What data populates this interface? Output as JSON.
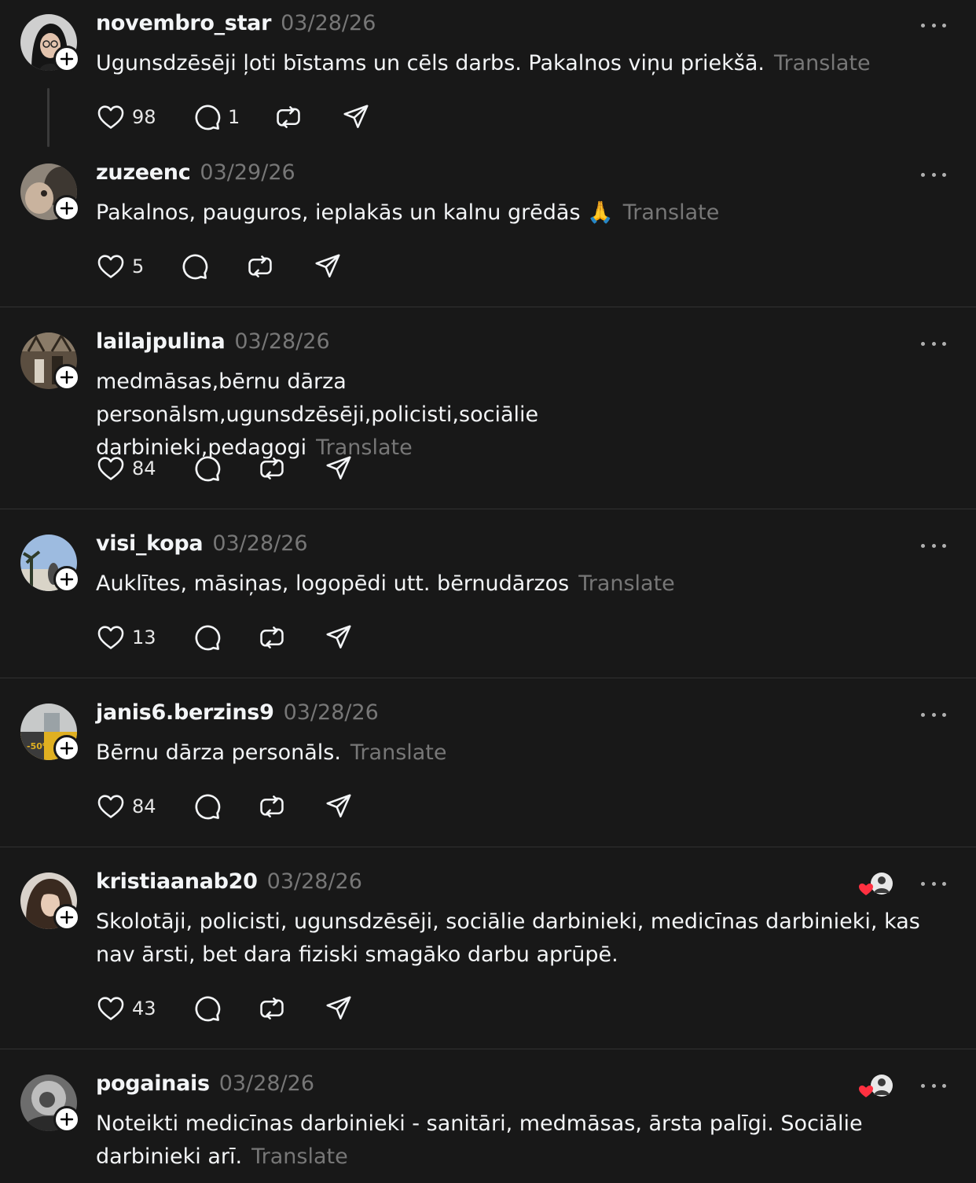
{
  "posts": [
    {
      "username": "novembro_star",
      "date": "03/28/26",
      "text": "Ugunsdzēsēji ļoti bīstams un cēls darbs. Pakalnos viņu priekšā.",
      "translate": "Translate",
      "likes": "98",
      "replies": "1"
    },
    {
      "username": "zuzeenc",
      "date": "03/29/26",
      "text": "Pakalnos, pauguros, ieplakās un kalnu grēdās 🙏",
      "translate": "Translate",
      "likes": "5",
      "replies": ""
    },
    {
      "username": "lailajpulina",
      "date": "03/28/26",
      "text": "medmāsas,bērnu dārza personālsm,ugunsdzēsēji,policisti,sociālie darbinieki,pedagogi",
      "translate": "Translate",
      "likes": "84",
      "replies": ""
    },
    {
      "username": "visi_kopa",
      "date": "03/28/26",
      "text": "Auklītes, māsiņas, logopēdi utt. bērnudārzos",
      "translate": "Translate",
      "likes": "13",
      "replies": ""
    },
    {
      "username": "janis6.berzins9",
      "date": "03/28/26",
      "text": "Bērnu dārza personāls.",
      "translate": "Translate",
      "likes": "84",
      "replies": ""
    },
    {
      "username": "kristiaanab20",
      "date": "03/28/26",
      "text": "Skolotāji, policisti, ugunsdzēsēji, sociālie darbinieki, medicīnas darbinieki, kas nav ārsti, bet dara fiziski smagāko darbu aprūpē.",
      "translate": "",
      "likes": "43",
      "replies": ""
    },
    {
      "username": "pogainais",
      "date": "03/28/26",
      "text": "Noteikti medicīnas darbinieki - sanitāri, medmāsas, ārsta palīgi. Sociālie darbinieki arī.",
      "translate": "Translate",
      "likes": "",
      "replies": ""
    }
  ],
  "icons": {
    "like": "heart-icon",
    "reply": "comment-icon",
    "repost": "repost-icon",
    "share": "share-icon",
    "more": "more-icon",
    "follow": "plus-icon",
    "liked_by": "liked-by-author-icon"
  },
  "colors": {
    "background": "#181818",
    "text": "#f3f5f7",
    "muted": "#777777",
    "divider": "#323232",
    "heart": "#ff3040"
  }
}
